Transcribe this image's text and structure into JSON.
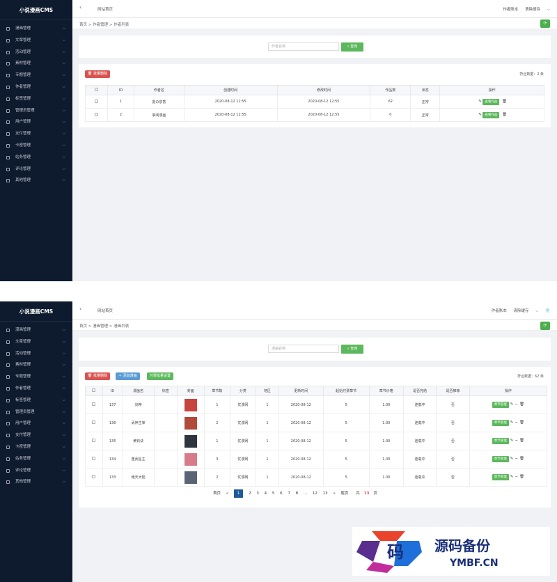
{
  "s1": {
    "brand": "小说漫画CMS",
    "topbar": {
      "tab": "网站首页",
      "right1": "作者账本",
      "right2": "清除缓存",
      "right3": "⌵"
    },
    "breadcrumb": "首页 > 作者管理 > 作者列表",
    "search": {
      "placeholder": "作者名称",
      "button": "查询"
    },
    "toolbar": {
      "delete": "批量删除"
    },
    "total_text": "符合数据：2 条",
    "columns": [
      "ID",
      "作者名",
      "创建时间",
      "修改时间",
      "作品数",
      "状态",
      "操作"
    ],
    "rows": [
      {
        "id": "1",
        "name": "愛の泉香",
        "created": "2020-08-12 12:55",
        "updated": "2020-08-12 12:55",
        "works": "62",
        "status": "正常",
        "action": "查看作品"
      },
      {
        "id": "2",
        "name": "掌阅漫画",
        "created": "2020-08-12 12:55",
        "updated": "2020-08-12 12:55",
        "works": "0",
        "status": "正常",
        "action": "查看作品"
      }
    ]
  },
  "s2": {
    "brand": "小说漫画CMS",
    "topbar": {
      "tab": "网站首页",
      "right1": "作者账本",
      "right2": "清除缓存",
      "right3": "⌵"
    },
    "breadcrumb": "首页 > 漫画管理 > 漫画列表",
    "search": {
      "placeholder": "漫画名称",
      "button": "查询"
    },
    "toolbar": {
      "delete": "批量删除",
      "add": "添加漫画",
      "batch": "付费批量设置"
    },
    "total_text": "符合数据：62 条",
    "columns": [
      "ID",
      "漫画名",
      "标签",
      "封面",
      "章节数",
      "分类",
      "地区",
      "更新时间",
      "起始付费章节",
      "章节价格",
      "是否完结",
      "是否推荐",
      "操作"
    ],
    "rows": [
      {
        "id": "137",
        "name": "剑帝",
        "tag": "",
        "chapters": "1",
        "category": "优漫网",
        "region": "1",
        "updated": "2020-08-12",
        "pay_start": "5",
        "price": "1.00",
        "finished": "连载中",
        "recommend": "否",
        "action": "章节管理",
        "cover": "#c8443f"
      },
      {
        "id": "136",
        "name": "武神主宰",
        "tag": "",
        "chapters": "2",
        "category": "优漫网",
        "region": "1",
        "updated": "2020-08-12",
        "pay_start": "5",
        "price": "1.00",
        "finished": "连载中",
        "recommend": "否",
        "action": "章节管理",
        "cover": "#b24a3a"
      },
      {
        "id": "135",
        "name": "黄钧诀",
        "tag": "",
        "chapters": "1",
        "category": "优漫网",
        "region": "1",
        "updated": "2020-08-12",
        "pay_start": "5",
        "price": "1.00",
        "finished": "连载中",
        "recommend": "否",
        "action": "章节管理",
        "cover": "#2e3440"
      },
      {
        "id": "134",
        "name": "重武星主",
        "tag": "",
        "chapters": "3",
        "category": "优漫网",
        "region": "1",
        "updated": "2020-08-12",
        "pay_start": "5",
        "price": "1.00",
        "finished": "连载中",
        "recommend": "否",
        "action": "章节管理",
        "cover": "#d77a8a"
      },
      {
        "id": "133",
        "name": "绝天大陆",
        "tag": "",
        "chapters": "2",
        "category": "优漫网",
        "region": "1",
        "updated": "2020-08-12",
        "pay_start": "5",
        "price": "1.00",
        "finished": "连载中",
        "recommend": "否",
        "action": "章节管理",
        "cover": "#5a6475"
      }
    ],
    "pager": {
      "prev": "首页",
      "lt": "«",
      "pages": [
        "1",
        "2",
        "3",
        "4",
        "5",
        "6",
        "7",
        "8",
        "...",
        "12",
        "13"
      ],
      "gt": "»",
      "last": "尾页",
      "total_prefix": "共",
      "total_num": "13",
      "total_suffix": "页"
    }
  },
  "sidebar": [
    "漫画管理",
    "文章管理",
    "活动管理",
    "素材管理",
    "专题管理",
    "作者管理",
    "标签管理",
    "管理员管理",
    "用户管理",
    "支付管理",
    "卡密管理",
    "站务管理",
    "评论管理",
    "其他管理"
  ],
  "watermark": {
    "glyph": "码",
    "title": "源码备份",
    "url": "YMBF.CN"
  },
  "colors": {
    "sidebar": "#0e1a2e",
    "green": "#5cb85c",
    "red": "#d9534f",
    "blue": "#5b9bd5",
    "pager_current": "#1e5a99"
  }
}
